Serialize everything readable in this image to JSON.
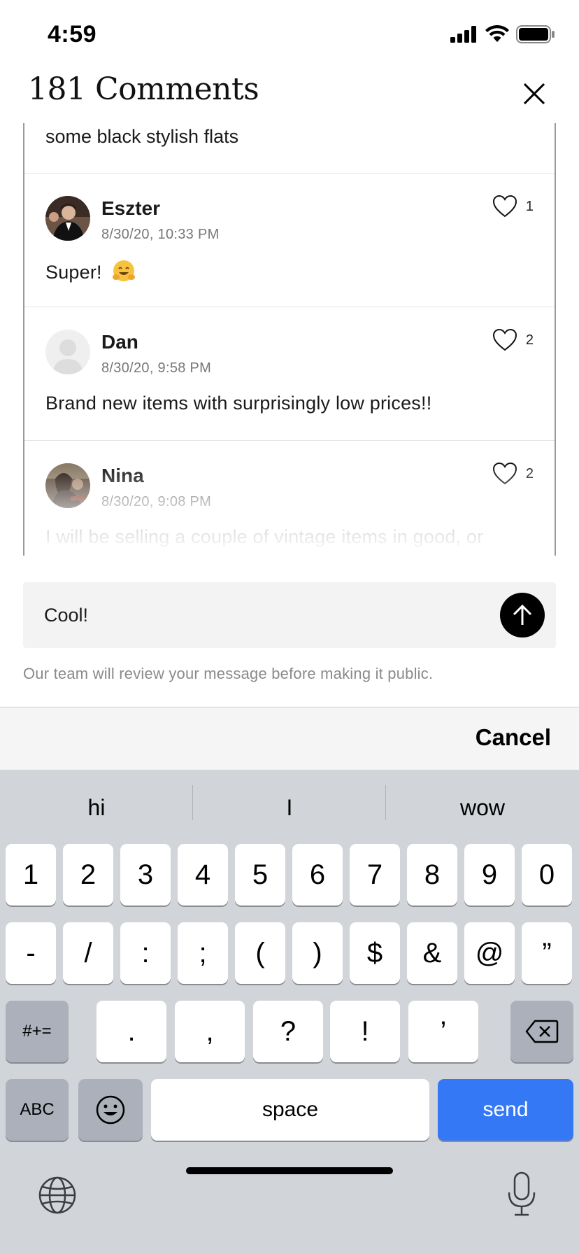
{
  "status": {
    "time": "4:59",
    "icons": [
      "cellular-signal-icon",
      "wifi-icon",
      "battery-icon"
    ]
  },
  "header": {
    "title": "181 Comments",
    "close_icon": "close-icon"
  },
  "comments": {
    "partial_text": "some black stylish flats",
    "items": [
      {
        "name": "Eszter",
        "date": "8/30/20, 10:33 PM",
        "text": "Super!",
        "likes": "1",
        "emoji": "hugging-face"
      },
      {
        "name": "Dan",
        "date": "8/30/20, 9:58 PM",
        "text": "Brand new items with surprisingly low prices!!",
        "likes": "2"
      },
      {
        "name": "Nina",
        "date": "8/30/20, 9:08 PM",
        "text": "I will be selling a couple of vintage items in good, or",
        "likes": "2"
      }
    ]
  },
  "composer": {
    "value": "Cool!",
    "send_icon": "arrow-up-icon",
    "note": "Our team will review your message before making it public."
  },
  "accessory": {
    "cancel": "Cancel"
  },
  "keyboard": {
    "suggestions": [
      "hi",
      "I",
      "wow"
    ],
    "row1": [
      "1",
      "2",
      "3",
      "4",
      "5",
      "6",
      "7",
      "8",
      "9",
      "0"
    ],
    "row2": [
      "-",
      "/",
      ":",
      ";",
      "(",
      ")",
      "$",
      "&",
      "@",
      "”"
    ],
    "row3_toggle": "#+=",
    "row3": [
      ".",
      ",",
      "?",
      "!",
      "’"
    ],
    "abc": "ABC",
    "space": "space",
    "send": "send"
  },
  "colors": {
    "send_key": "#3478f6",
    "keyboard_bg": "#d1d4d9"
  }
}
